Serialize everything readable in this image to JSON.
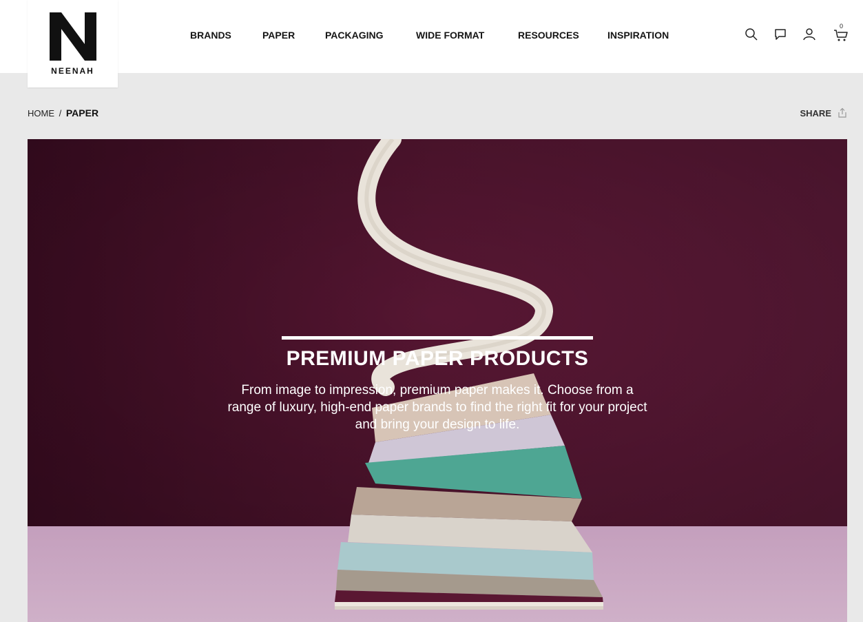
{
  "brand": {
    "initial": "N",
    "wordmark": "NEENAH"
  },
  "nav": {
    "items": [
      {
        "label": "BRANDS"
      },
      {
        "label": "PAPER"
      },
      {
        "label": "PACKAGING"
      },
      {
        "label": "WIDE FORMAT"
      },
      {
        "label": "RESOURCES"
      },
      {
        "label": "INSPIRATION"
      }
    ]
  },
  "header_icons": {
    "search": "search-icon",
    "chat": "chat-icon",
    "account": "user-icon",
    "cart": "cart-icon",
    "cart_count": "0"
  },
  "breadcrumb": {
    "home": "HOME",
    "separator": "/",
    "current": "PAPER"
  },
  "share": {
    "label": "SHARE",
    "icon": "share-icon"
  },
  "hero": {
    "title": "PREMIUM PAPER PRODUCTS",
    "text": "From image to impression, premium paper makes it. Choose from a range of luxury, high-end paper brands to find the right fit for your project and bring your design to life."
  },
  "colors": {
    "header_bg": "#ffffff",
    "page_bg": "#e9e9e9",
    "hero_wall": "#5a1733",
    "hero_floor": "#c9a6c2",
    "accent_teal": "#4aa692"
  }
}
